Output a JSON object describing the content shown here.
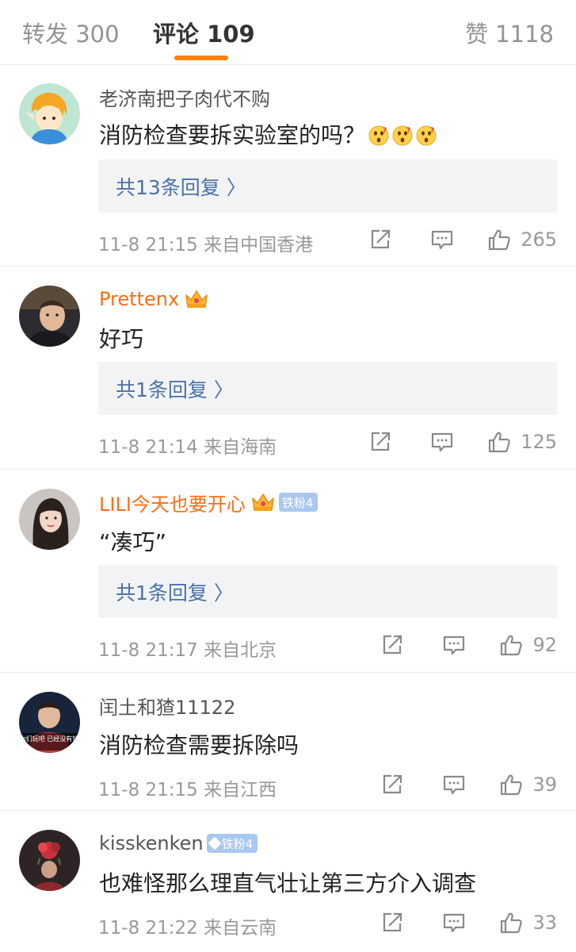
{
  "tabs": [
    {
      "label": "转发 300"
    },
    {
      "label": "评论 109"
    },
    {
      "label": "赞 1118"
    }
  ],
  "comments": [
    {
      "username": "老济南把子肉代不购",
      "text": "消防检查要拆实验室的吗？",
      "replies": "共13条回复 〉",
      "time": "11-8 21:15",
      "location": "来自中国香港",
      "likes": "265"
    },
    {
      "username": "Prettenx",
      "text": "好巧",
      "replies": "共1条回复 〉",
      "time": "11-8 21:14",
      "location": "来自海南",
      "likes": "125"
    },
    {
      "username": "LILI今天也要开心",
      "badge": "铁粉4",
      "text": "“凑巧”",
      "replies": "共1条回复 〉",
      "time": "11-8 21:17",
      "location": "来自北京",
      "likes": "92"
    },
    {
      "username": "闰土和猹11122",
      "text": "消防检查需要拆除吗",
      "time": "11-8 21:15",
      "location": "来自江西",
      "likes": "39"
    },
    {
      "username": "kisskenken",
      "badge": "铁粉4",
      "text": "也难怪那么理直气壮让第三方介入调查",
      "time": "11-8 21:22",
      "location": "来自云南",
      "likes": "33"
    }
  ],
  "avatar_texts": {
    "c4": "你们玩吧 已经没有钱"
  },
  "colors": {
    "accent": "#ff8200",
    "vip_name": "#f86e17",
    "reply_link": "#4a72a6"
  }
}
